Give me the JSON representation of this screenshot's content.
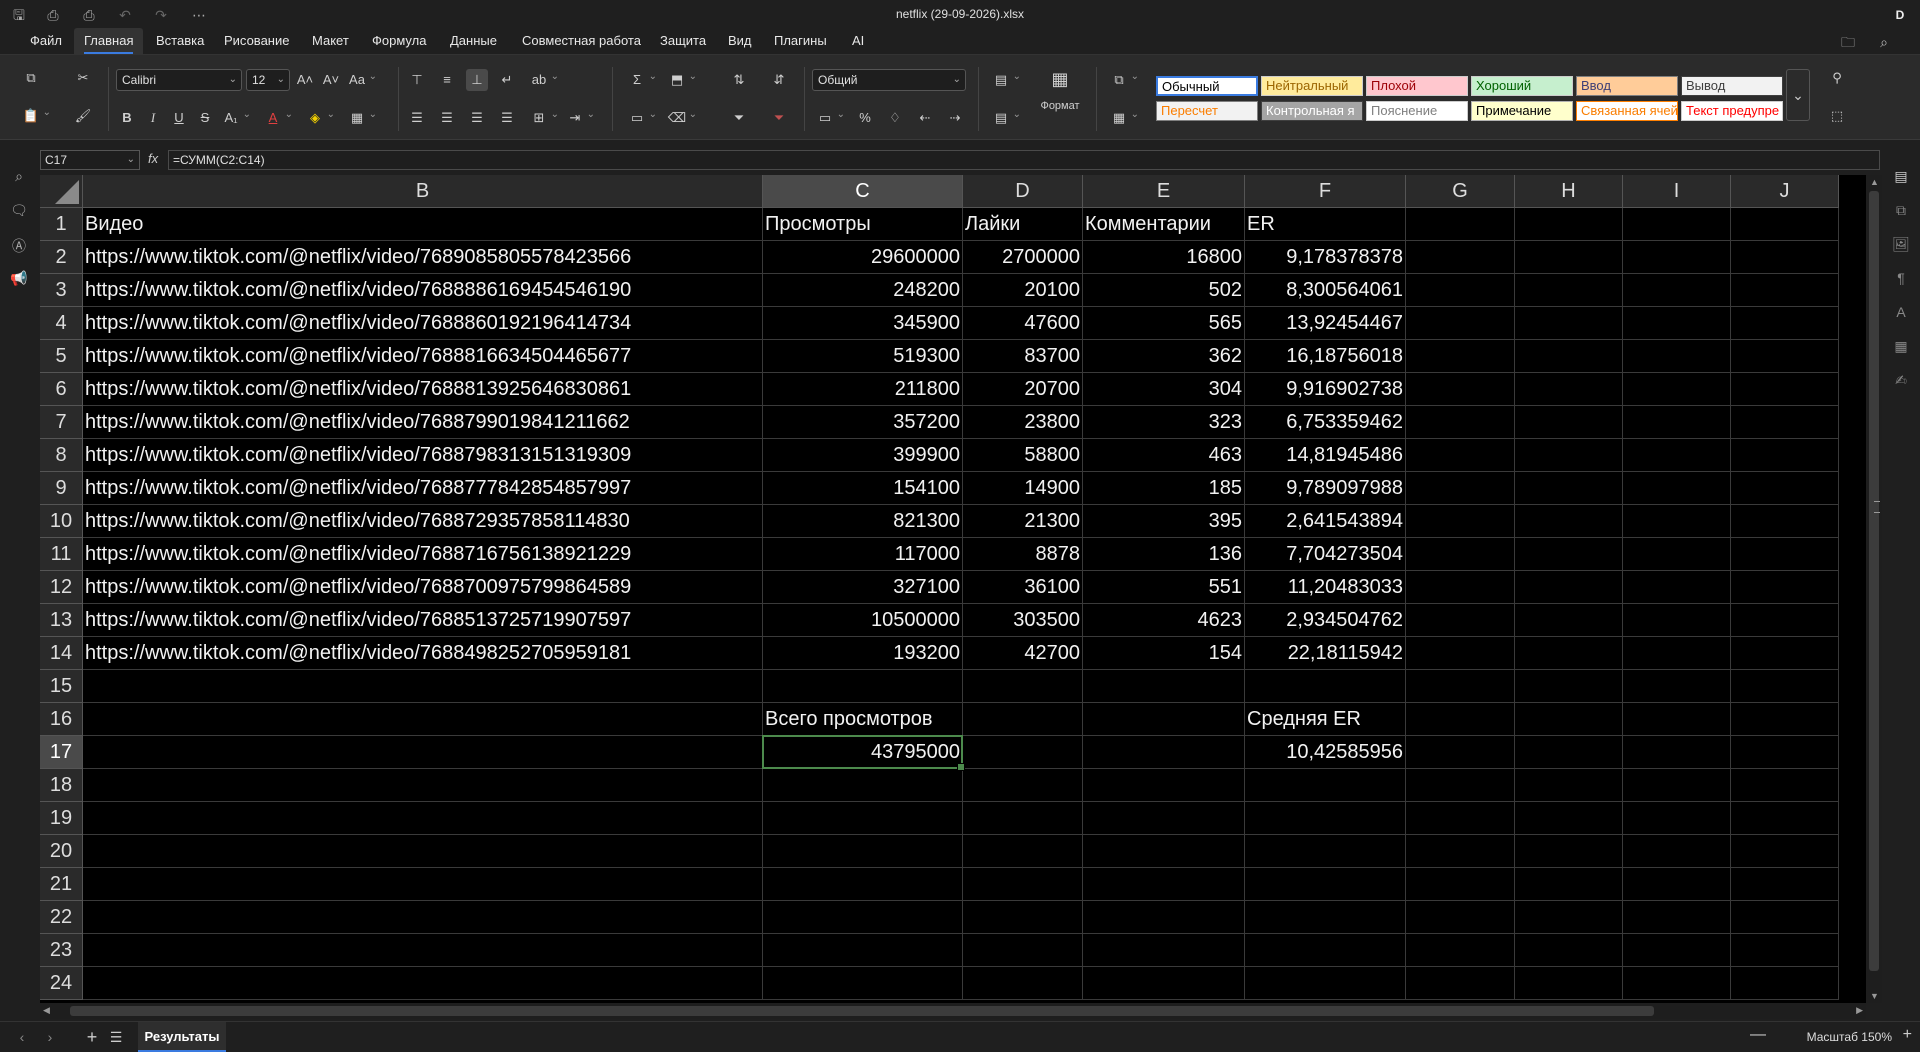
{
  "window": {
    "title": "netflix (29-09-2026).xlsx",
    "user_initial": "D"
  },
  "menu": {
    "tabs": [
      "Файл",
      "Главная",
      "Вставка",
      "Рисование",
      "Макет",
      "Формула",
      "Данные",
      "Совместная работа",
      "Защита",
      "Вид",
      "Плагины",
      "AI"
    ],
    "active": "Главная"
  },
  "ribbon": {
    "font_name": "Calibri",
    "font_size": "12",
    "number_format": "Общий",
    "format_label": "Формат",
    "cell_styles": [
      {
        "label": "Обычный",
        "bg": "#ffffff",
        "fg": "#000000",
        "border": "#3a7be0"
      },
      {
        "label": "Нейтральный",
        "bg": "#ffeb9c",
        "fg": "#9c6500",
        "border": "#cccccc"
      },
      {
        "label": "Плохой",
        "bg": "#ffc7ce",
        "fg": "#9c0006",
        "border": "#cccccc"
      },
      {
        "label": "Хороший",
        "bg": "#c6efce",
        "fg": "#006100",
        "border": "#cccccc"
      },
      {
        "label": "Ввод",
        "bg": "#ffcc99",
        "fg": "#3f3f76",
        "border": "#7f7f7f"
      },
      {
        "label": "Вывод",
        "bg": "#f2f2f2",
        "fg": "#3f3f3f",
        "border": "#3f3f3f"
      },
      {
        "label": "Пересчет",
        "bg": "#f2f2f2",
        "fg": "#fa7d00",
        "border": "#7f7f7f"
      },
      {
        "label": "Контрольная я",
        "bg": "#a5a5a5",
        "fg": "#ffffff",
        "border": "#3f3f3f"
      },
      {
        "label": "Пояснение",
        "bg": "#ffffff",
        "fg": "#7f7f7f",
        "border": "#cccccc"
      },
      {
        "label": "Примечание",
        "bg": "#ffffcc",
        "fg": "#000000",
        "border": "#b2b2b2"
      },
      {
        "label": "Связанная ячей",
        "bg": "#ffffff",
        "fg": "#fa7d00",
        "border": "#ff8001"
      },
      {
        "label": "Текст предупре",
        "bg": "#ffffff",
        "fg": "#ff0000",
        "border": "#cccccc"
      }
    ]
  },
  "formula_bar": {
    "name_box": "C17",
    "fx": "fx",
    "formula": "=СУММ(C2:C14)"
  },
  "grid": {
    "columns": [
      "B",
      "C",
      "D",
      "E",
      "F",
      "G",
      "H",
      "I",
      "J"
    ],
    "selected_column": "C",
    "rows": [
      "1",
      "2",
      "3",
      "4",
      "5",
      "6",
      "7",
      "8",
      "9",
      "10",
      "11",
      "12",
      "13",
      "14",
      "15",
      "16",
      "17",
      "18",
      "19",
      "20",
      "21",
      "22",
      "23",
      "24"
    ],
    "selected_row": "17",
    "header": [
      "Видео",
      "Просмотры",
      "Лайки",
      "Комментарии",
      "ER"
    ],
    "data": [
      [
        "https://www.tiktok.com/@netflix/video/7689085805578423566",
        "29600000",
        "2700000",
        "16800",
        "9,178378378"
      ],
      [
        "https://www.tiktok.com/@netflix/video/7688886169454546190",
        "248200",
        "20100",
        "502",
        "8,300564061"
      ],
      [
        "https://www.tiktok.com/@netflix/video/7688860192196414734",
        "345900",
        "47600",
        "565",
        "13,92454467"
      ],
      [
        "https://www.tiktok.com/@netflix/video/7688816634504465677",
        "519300",
        "83700",
        "362",
        "16,18756018"
      ],
      [
        "https://www.tiktok.com/@netflix/video/7688813925646830861",
        "211800",
        "20700",
        "304",
        "9,916902738"
      ],
      [
        "https://www.tiktok.com/@netflix/video/7688799019841211662",
        "357200",
        "23800",
        "323",
        "6,753359462"
      ],
      [
        "https://www.tiktok.com/@netflix/video/7688798313151319309",
        "399900",
        "58800",
        "463",
        "14,81945486"
      ],
      [
        "https://www.tiktok.com/@netflix/video/7688777842854857997",
        "154100",
        "14900",
        "185",
        "9,789097988"
      ],
      [
        "https://www.tiktok.com/@netflix/video/7688729357858114830",
        "821300",
        "21300",
        "395",
        "2,641543894"
      ],
      [
        "https://www.tiktok.com/@netflix/video/7688716756138921229",
        "117000",
        "8878",
        "136",
        "7,704273504"
      ],
      [
        "https://www.tiktok.com/@netflix/video/7688700975799864589",
        "327100",
        "36100",
        "551",
        "11,20483033"
      ],
      [
        "https://www.tiktok.com/@netflix/video/7688513725719907597",
        "10500000",
        "303500",
        "4623",
        "2,934504762"
      ],
      [
        "https://www.tiktok.com/@netflix/video/7688498252705959181",
        "193200",
        "42700",
        "154",
        "22,18115942"
      ]
    ],
    "summary_labels": {
      "total_views": "Всего просмотров",
      "avg_er": "Средняя ER"
    },
    "summary_values": {
      "total_views": "43795000",
      "avg_er": "10,42585956"
    }
  },
  "sheets": {
    "tabs": [
      "Результаты"
    ],
    "active": "Результаты"
  },
  "status": {
    "zoom": "Масштаб 150%"
  }
}
